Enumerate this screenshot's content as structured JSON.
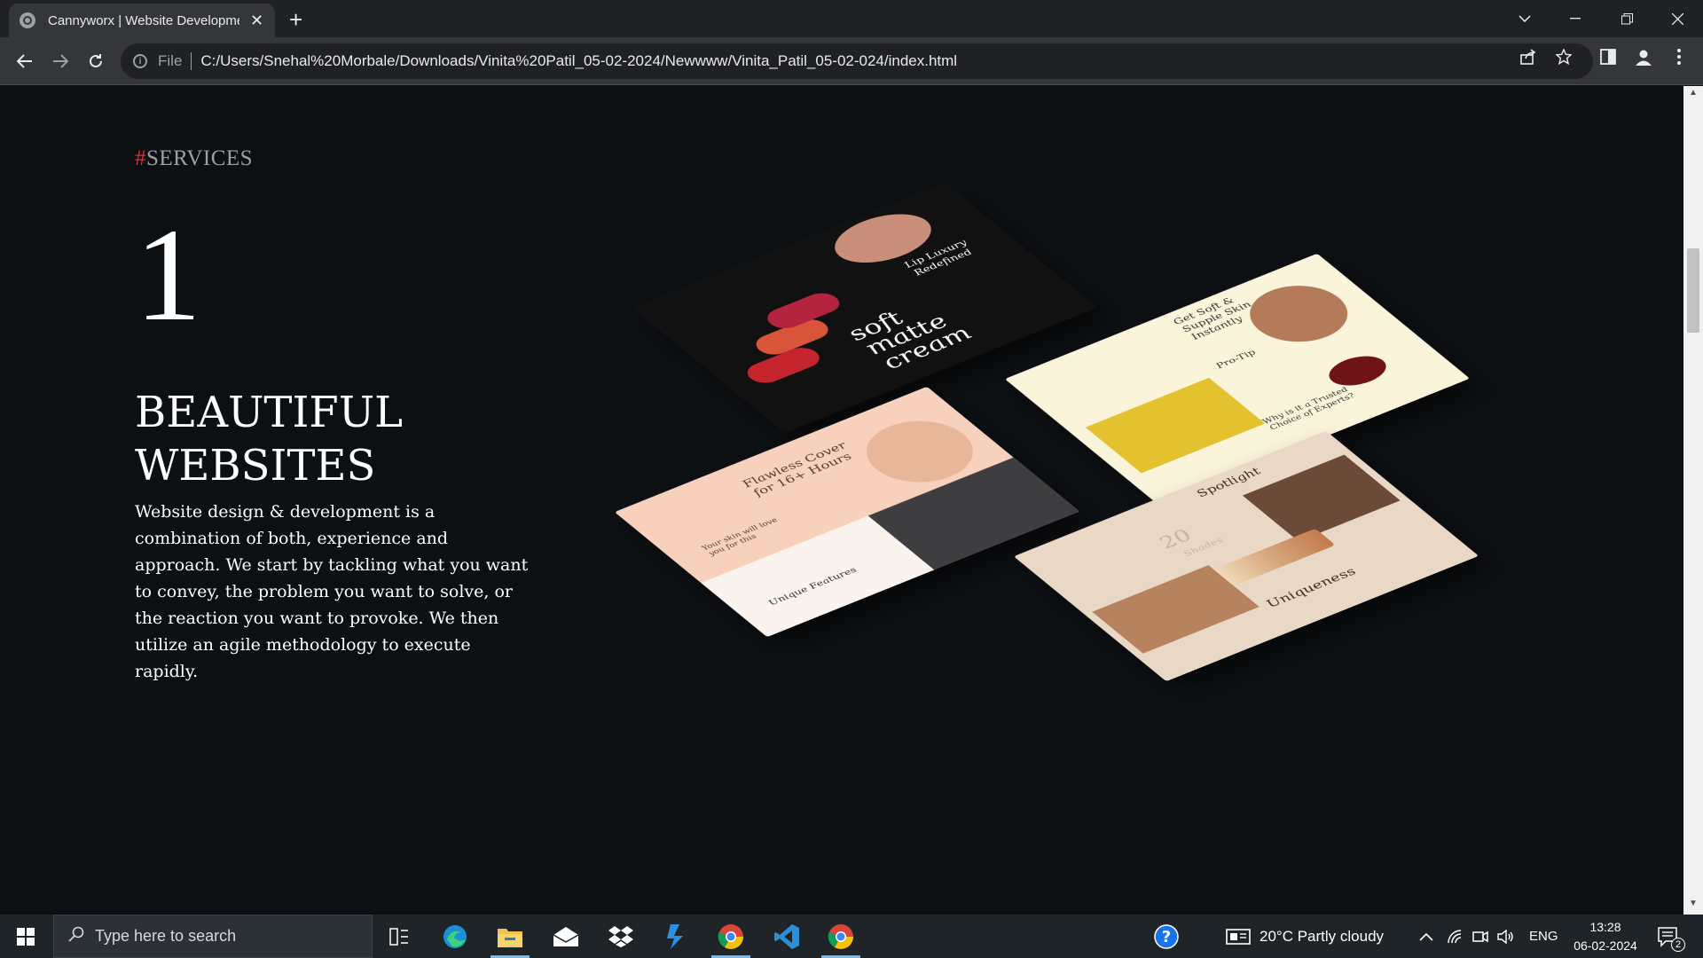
{
  "browser": {
    "tab_title": "Cannyworx | Website Developme",
    "new_tab": "+",
    "close": "✕",
    "scheme": "File",
    "url": "C:/Users/Snehal%20Morbale/Downloads/Vinita%20Patil_05-02-2024/Newwww/Vinita_Patil_05-02-024/index.html"
  },
  "page": {
    "eyebrow_hash": "#",
    "eyebrow_text": "SERVICES",
    "number": "1",
    "heading_line1": "BEAUTIFUL",
    "heading_line2": "WEBSITES",
    "body": "Website design & development is a combination of both, experience and approach. We start by tackling what you want to convey, the problem you want to solve, or the reaction you want to provoke. We then utilize an agile methodology to execute rapidly."
  },
  "mockups": {
    "card1_title": "soft matte cream",
    "card1_sub": "Lip Luxury Redefined",
    "card2_title": "Get Soft & Supple Skin Instantly",
    "card2_sub": "Pro-Tip",
    "card2_note": "Why is it a Trusted Choice of Experts?",
    "card3_title": "Flawless Cover for 16+ Hours",
    "card3_sub": "Unique Features",
    "card3_note": "Your skin will love you for this",
    "card4_title": "Spotlight",
    "card4_sub": "Uniqueness",
    "card4_num": "20",
    "card4_numlabel": "Shades"
  },
  "taskbar": {
    "search_placeholder": "Type here to search",
    "weather": "20°C  Partly cloudy",
    "language": "ENG",
    "time": "13:28",
    "date": "06-02-2024",
    "notifications": "2"
  },
  "icons": [
    "globe-icon",
    "back-icon",
    "forward-icon",
    "reload-icon",
    "share-icon",
    "star-icon",
    "sidepanel-icon",
    "profile-icon",
    "menu-icon",
    "windows-icon",
    "search-icon",
    "taskview-icon",
    "edge-icon",
    "explorer-icon",
    "mail-icon",
    "dropbox-icon",
    "app-icon",
    "chrome-icon",
    "vscode-icon",
    "help-icon",
    "weather-icon",
    "chevron-up-icon",
    "network-icon",
    "meet-icon",
    "volume-icon",
    "notification-icon"
  ]
}
